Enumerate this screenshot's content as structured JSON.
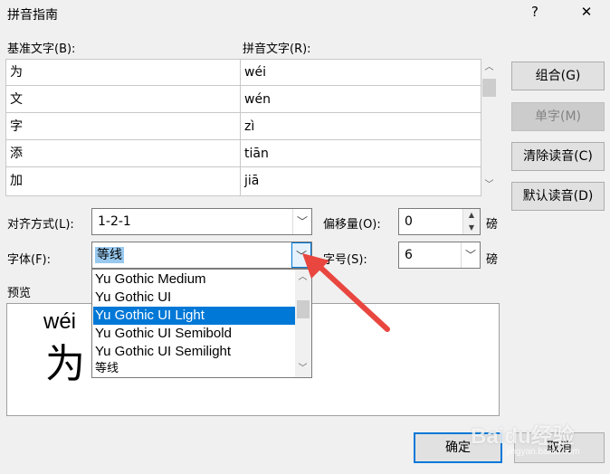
{
  "window": {
    "title": "拼音指南",
    "help_glyph": "?",
    "close_glyph": "✕"
  },
  "labels": {
    "base_text": "基准文字(B):",
    "pinyin_text": "拼音文字(R):",
    "align": "对齐方式(L):",
    "offset": "偏移量(O):",
    "font": "字体(F):",
    "size": "字号(S):",
    "preview": "预览",
    "pound1": "磅",
    "pound2": "磅"
  },
  "rows": [
    {
      "base": "为",
      "pinyin": "wéi"
    },
    {
      "base": "文",
      "pinyin": "wén"
    },
    {
      "base": "字",
      "pinyin": "zì"
    },
    {
      "base": "添",
      "pinyin": "tiān"
    },
    {
      "base": "加",
      "pinyin": "jiā"
    }
  ],
  "buttons": {
    "group": "组合(G)",
    "single": "单字(M)",
    "clear": "清除读音(C)",
    "default_reading": "默认读音(D)",
    "ok": "确定",
    "cancel": "取消"
  },
  "fields": {
    "align_value": "1-2-1",
    "offset_value": "0",
    "font_value": "等线",
    "size_value": "6"
  },
  "font_options": [
    "Yu Gothic Medium",
    "Yu Gothic UI",
    "Yu Gothic UI Light",
    "Yu Gothic UI Semibold",
    "Yu Gothic UI Semilight",
    "等线"
  ],
  "font_options_selected": "Yu Gothic UI Light",
  "preview": {
    "pinyin": "wéi",
    "char": "为"
  },
  "watermark": {
    "text": "Baidu经验",
    "sub": "jingyan.baidu.com"
  },
  "colors": {
    "accent": "#0078d7",
    "arrow": "#e8463f"
  }
}
